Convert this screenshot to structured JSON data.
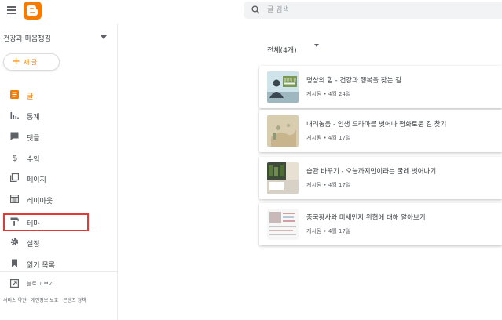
{
  "header": {
    "search_placeholder": "글 검색"
  },
  "sidebar": {
    "blog_name": "건강과 마음챙김",
    "new_post": {
      "plus": "+",
      "label": "새 글"
    },
    "items": [
      {
        "label": "글",
        "icon": "posts-icon",
        "active": true
      },
      {
        "label": "통계",
        "icon": "stats-icon"
      },
      {
        "label": "댓글",
        "icon": "comments-icon"
      },
      {
        "label": "수익",
        "icon": "earnings-icon"
      },
      {
        "label": "페이지",
        "icon": "pages-icon"
      },
      {
        "label": "레이아웃",
        "icon": "layout-icon"
      },
      {
        "label": "테마",
        "icon": "theme-icon"
      },
      {
        "label": "설정",
        "icon": "settings-icon"
      },
      {
        "label": "읽기 목록",
        "icon": "reading-list-icon"
      }
    ],
    "view_blog": "블로그 보기",
    "footer": "서비스 약관 · 개인정보 보호 · 콘텐츠 정책"
  },
  "main": {
    "filter_label": "전체(4개)",
    "posts": [
      {
        "title": "명상의 힘 - 건강과 행복을 찾는 길",
        "meta": "게시됨 • 4월 24일",
        "thumb_text": "명상의 힘"
      },
      {
        "title": "내려놓음 - 인생 드라마를 벗어나 평화로운 길 찾기",
        "meta": "게시됨 • 4월 17일"
      },
      {
        "title": "습관 바꾸기 - 오늘까지만이라는 굴레 벗어나기",
        "meta": "게시됨 • 4월 17일"
      },
      {
        "title": "중국황사와 미세먼지 위협에 대해 알아보기",
        "meta": "게시됨 • 4월 17일"
      }
    ]
  },
  "colors": {
    "accent": "#f57c00",
    "highlight": "#e53935"
  }
}
